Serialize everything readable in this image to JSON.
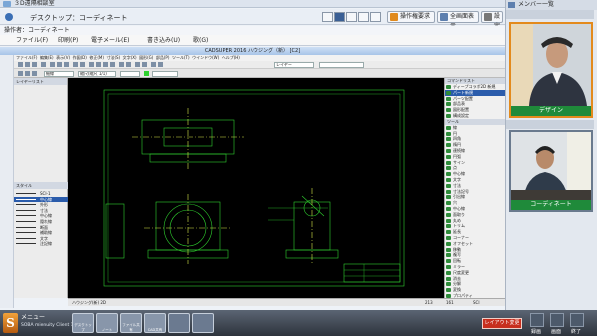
{
  "app": {
    "title": "３D遠隔相談室"
  },
  "toolbar": {
    "desktop_title": "デスクトップ：コーディネート",
    "operator": "操作者：コーディネート",
    "operate_request": "操作権要求",
    "fullscreen": "全画面表示",
    "settings": "設定"
  },
  "menu": {
    "items": [
      "ファイル(F)",
      "印刷(P)",
      "電子メール(E)",
      "書き込み(U)",
      "歌(G)"
    ]
  },
  "cad": {
    "title": "CADSUPER 2016 ハウジング（新）  [C2]",
    "menu_items": [
      "ファイル(F)",
      "編集(E)",
      "表示(V)",
      "作図(D)",
      "修正(M)",
      "寸法(S)",
      "文字(X)",
      "図形(G)",
      "部品(P)",
      "ツール(T)",
      "ウインドウ(W)",
      "ヘルプ(H)"
    ],
    "scale_combo": "縮尺(縮尺 1/1)",
    "line_combo": "細線",
    "layer_combo": "レイヤー",
    "layer_panel_title": "レイヤーリスト",
    "layer_sub_title": "スタイル",
    "layers": [
      {
        "name": "SCI-1"
      },
      {
        "name": "中心線",
        "selected": true
      },
      {
        "name": "外形"
      },
      {
        "name": "寸法"
      },
      {
        "name": "中心線"
      },
      {
        "name": "隠れ線"
      },
      {
        "name": "断面"
      },
      {
        "name": "補助線"
      },
      {
        "name": "文字"
      },
      {
        "name": "注記線"
      }
    ],
    "right_panel_title1": "コマンドリスト",
    "right_items1": [
      "ディープコラボ2D 新規",
      "パート新規",
      "パーツ配置",
      "部品表",
      "図形配置",
      "構成設定"
    ],
    "right_panel_title2": "ツール",
    "right_items2": [
      "線",
      "円",
      "四角",
      "楕円",
      "連続線",
      "円弧",
      "サイン",
      "点",
      "中心線",
      "文字",
      "寸法",
      "寸法記号",
      "引出線",
      "穴",
      "中心線",
      "面取り",
      "丸め",
      "トリム",
      "延長",
      "コーナー",
      "オフセット",
      "移動",
      "複写",
      "回転",
      "ミラー",
      "尺度変更",
      "消去",
      "分解",
      "変換",
      "プロパティ"
    ],
    "status_left": "ハウジング(新)  2D",
    "status_nums": [
      "213",
      "161",
      "SCI"
    ]
  },
  "members": {
    "title": "メンバー一覧",
    "member1_label": "デザイン",
    "member2_label": "コーディネート"
  },
  "taskbar": {
    "menu": "メニュー",
    "client": "SOBA mienuity Client 1.2.2",
    "apps": [
      "デスクトップ",
      "ノート",
      "ファイル共有",
      "CAD共有"
    ],
    "layout_button": "レイアウト変更",
    "record": "録画",
    "capture": "画面",
    "exit": "終了"
  },
  "colors": {
    "accent": "#e38a1c",
    "drawing_bg": "#000000",
    "line": "#2fd12f",
    "selection": "#2b5cab"
  }
}
